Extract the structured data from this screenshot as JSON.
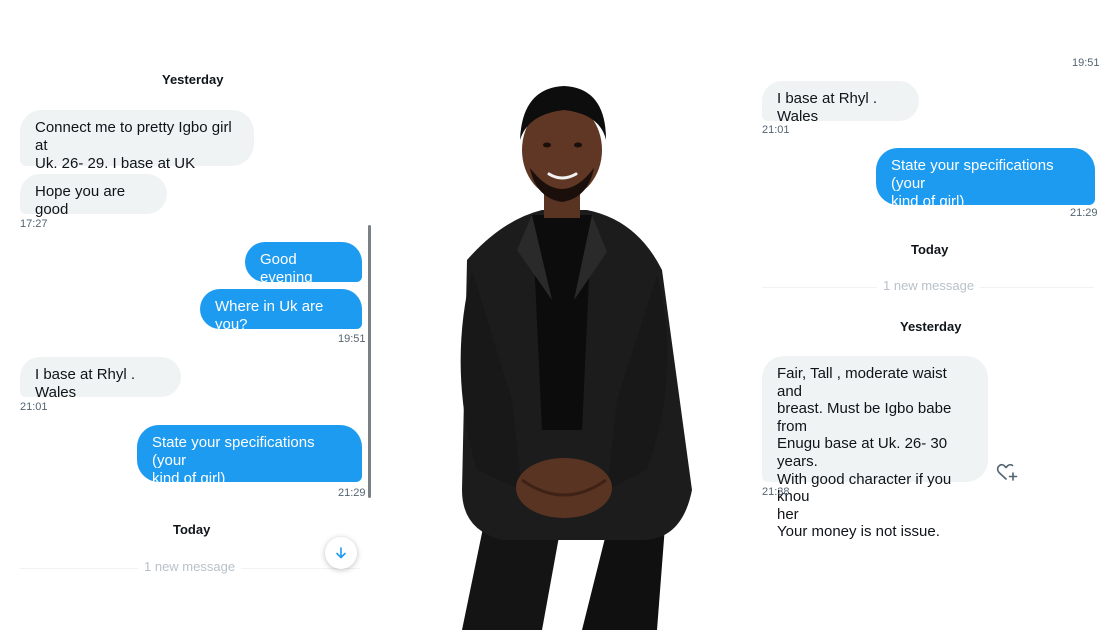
{
  "left_chat": {
    "header_yesterday": "Yesterday",
    "msg1": "Connect me to pretty Igbo girl at\nUk. 26- 29. I base at UK",
    "msg2": "Hope you are good",
    "ts1": "17:27",
    "msg3": "Good evening",
    "msg4": "Where in Uk are you?",
    "ts2": "19:51",
    "msg5": "I base at Rhyl . Wales",
    "ts3": "21:01",
    "msg6": "State your specifications (your\nkind of girl)",
    "ts4": "21:29",
    "header_today": "Today",
    "new_message": "1 new message"
  },
  "right_chat": {
    "ts0": "19:51",
    "msg1": "I base at Rhyl . Wales",
    "ts1": "21:01",
    "msg2": "State your specifications (your\nkind of girl)",
    "ts2": "21:29",
    "header_today": "Today",
    "new_message": "1 new message",
    "header_yesterday": "Yesterday",
    "msg3": "Fair, Tall , moderate waist  and\nbreast. Must be Igbo babe from\nEnugu base at Uk. 26- 30 years.\nWith good character if you knou\nher\nYour money is not issue.",
    "ts3": "21:38"
  },
  "icons": {
    "scroll_down": "arrow-down-icon",
    "react": "heart-plus-icon"
  },
  "colors": {
    "accent": "#1d9bf0",
    "incoming_bubble": "#eff3f4",
    "timestamp": "#536471"
  }
}
